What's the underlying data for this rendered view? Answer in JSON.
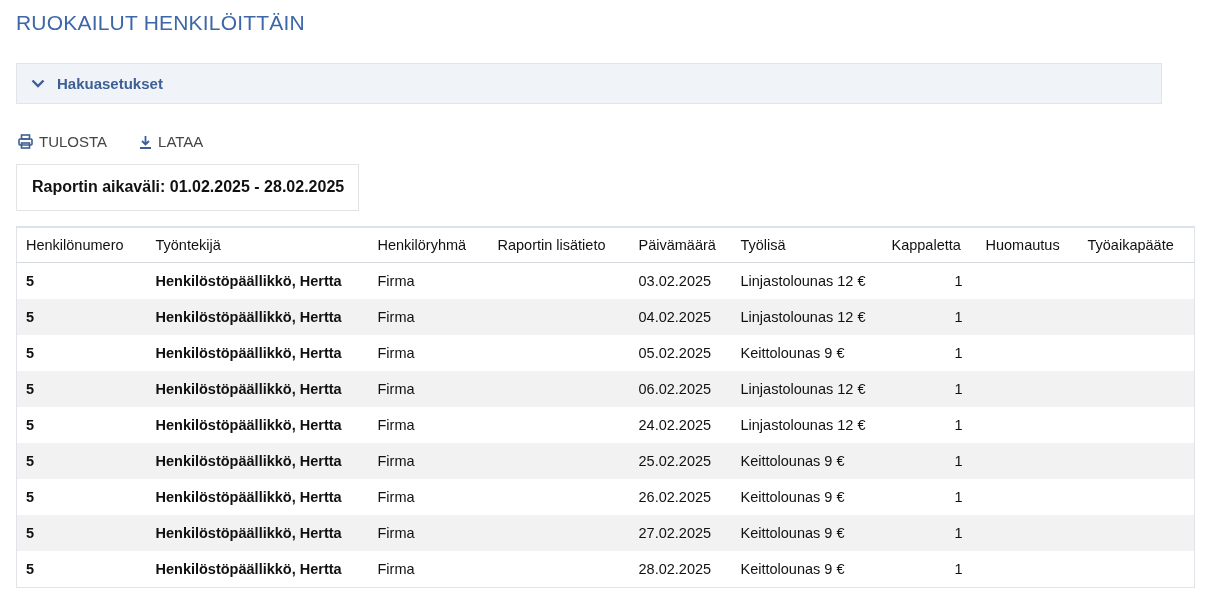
{
  "page_title": "RUOKAILUT HENKILÖITTÄIN",
  "search_panel": {
    "label": "Hakuasetukset",
    "expanded": false
  },
  "actions": [
    {
      "kind": "print",
      "label": "TULOSTA"
    },
    {
      "kind": "download",
      "label": "LATAA"
    }
  ],
  "report_range": "Raportin aikaväli: 01.02.2025 - 28.02.2025",
  "table": {
    "columns": [
      "Henkilönumero",
      "Työntekijä",
      "Henkilöryhmä",
      "Raportin lisätieto",
      "Päivämäärä",
      "Työlisä",
      "Kappaletta",
      "Huomautus",
      "Työaikapääte"
    ],
    "rows": [
      [
        "5",
        "Henkilöstöpäällikkö, Hertta",
        "Firma",
        "",
        "03.02.2025",
        "Linjastolounas 12 €",
        "1",
        "",
        ""
      ],
      [
        "5",
        "Henkilöstöpäällikkö, Hertta",
        "Firma",
        "",
        "04.02.2025",
        "Linjastolounas 12 €",
        "1",
        "",
        ""
      ],
      [
        "5",
        "Henkilöstöpäällikkö, Hertta",
        "Firma",
        "",
        "05.02.2025",
        "Keittolounas 9 €",
        "1",
        "",
        ""
      ],
      [
        "5",
        "Henkilöstöpäällikkö, Hertta",
        "Firma",
        "",
        "06.02.2025",
        "Linjastolounas 12 €",
        "1",
        "",
        ""
      ],
      [
        "5",
        "Henkilöstöpäällikkö, Hertta",
        "Firma",
        "",
        "24.02.2025",
        "Linjastolounas 12 €",
        "1",
        "",
        ""
      ],
      [
        "5",
        "Henkilöstöpäällikkö, Hertta",
        "Firma",
        "",
        "25.02.2025",
        "Keittolounas 9 €",
        "1",
        "",
        ""
      ],
      [
        "5",
        "Henkilöstöpäällikkö, Hertta",
        "Firma",
        "",
        "26.02.2025",
        "Keittolounas 9 €",
        "1",
        "",
        ""
      ],
      [
        "5",
        "Henkilöstöpäällikkö, Hertta",
        "Firma",
        "",
        "27.02.2025",
        "Keittolounas 9 €",
        "1",
        "",
        ""
      ],
      [
        "5",
        "Henkilöstöpäällikkö, Hertta",
        "Firma",
        "",
        "28.02.2025",
        "Keittolounas 9 €",
        "1",
        "",
        ""
      ]
    ]
  }
}
